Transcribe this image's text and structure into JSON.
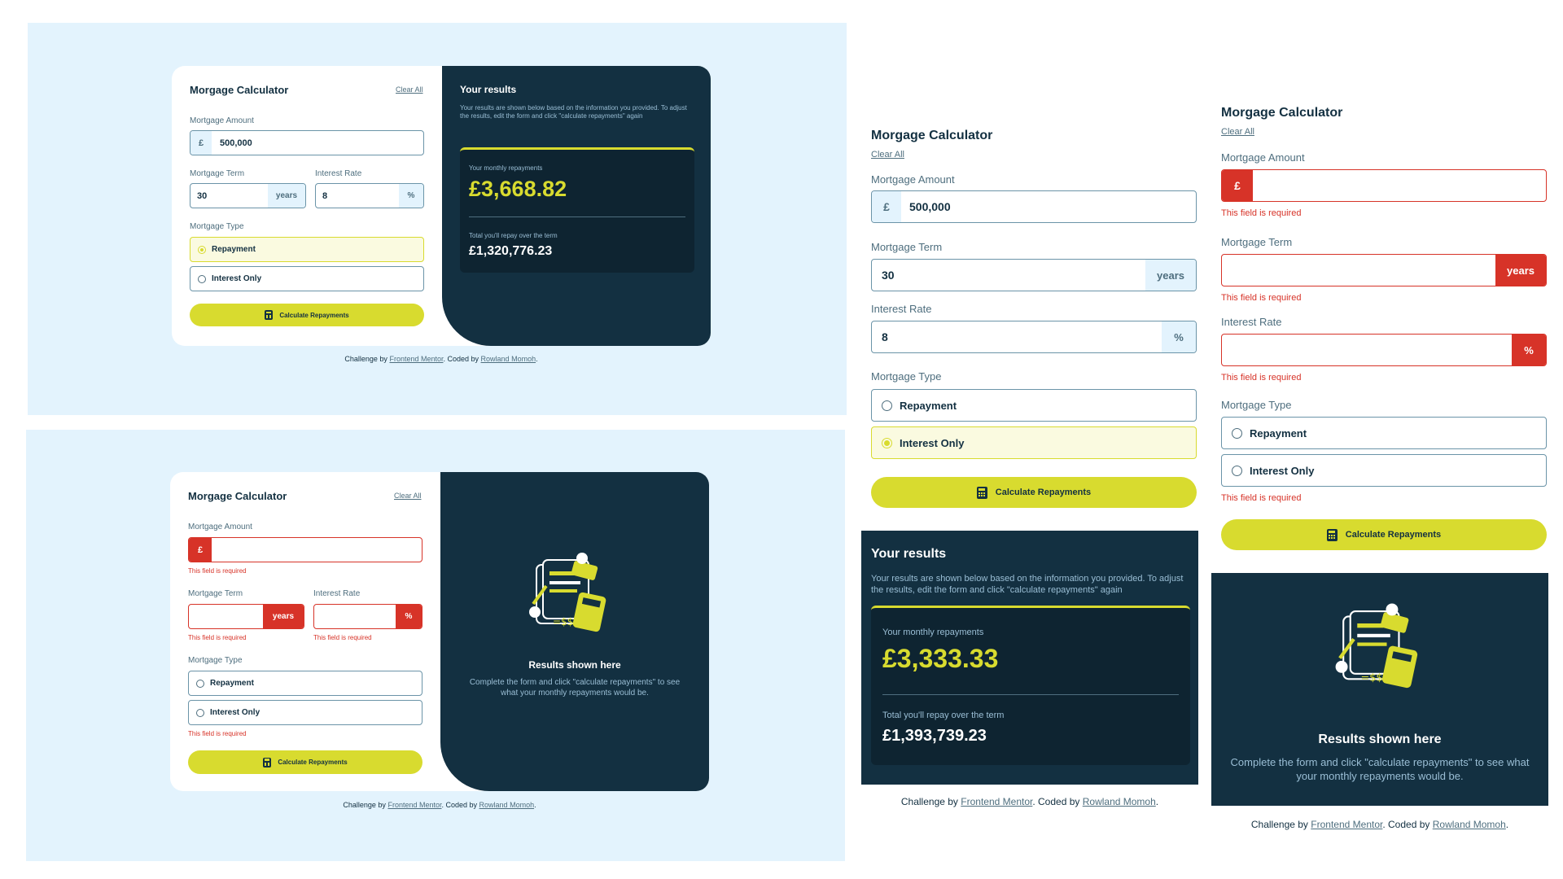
{
  "form": {
    "title": "Morgage Calculator",
    "clear_all": "Clear All",
    "amount_label": "Mortgage Amount",
    "currency": "£",
    "term_label": "Mortgage Term",
    "term_unit": "years",
    "rate_label": "Interest Rate",
    "rate_unit": "%",
    "type_label": "Mortgage Type",
    "repayment": "Repayment",
    "interest_only": "Interest Only",
    "calculate": "Calculate Repayments",
    "error": "This field is required"
  },
  "top_left": {
    "amount": "500,000",
    "term": "30",
    "rate": "8",
    "selected_type": "Repayment",
    "results_title": "Your results",
    "results_desc": "Your results are shown below based on the information you provided. To adjust the results, edit the form and click \"calculate repayments\" again",
    "monthly_label": "Your monthly repayments",
    "monthly": "£3,668.82",
    "total_label": "Total you'll repay over the term",
    "total": "£1,320,776.23"
  },
  "mobile_filled": {
    "amount": "500,000",
    "term": "30",
    "rate": "8",
    "selected_type": "Interest Only",
    "monthly": "£3,333.33",
    "total": "£1,393,739.23"
  },
  "empty_state": {
    "title": "Results shown here",
    "desc": "Complete the form and click \"calculate repayments\" to see what your monthly repayments would be."
  },
  "footer": {
    "prefix": "Challenge by",
    "fm": "Frontend Mentor",
    "mid": ". Coded by",
    "author": "Rowland Momoh",
    "suffix": "."
  },
  "colors": {
    "lime": "#d8db2f",
    "slate_900": "#133041",
    "red": "#d73328",
    "sky": "#e3f3fd"
  }
}
